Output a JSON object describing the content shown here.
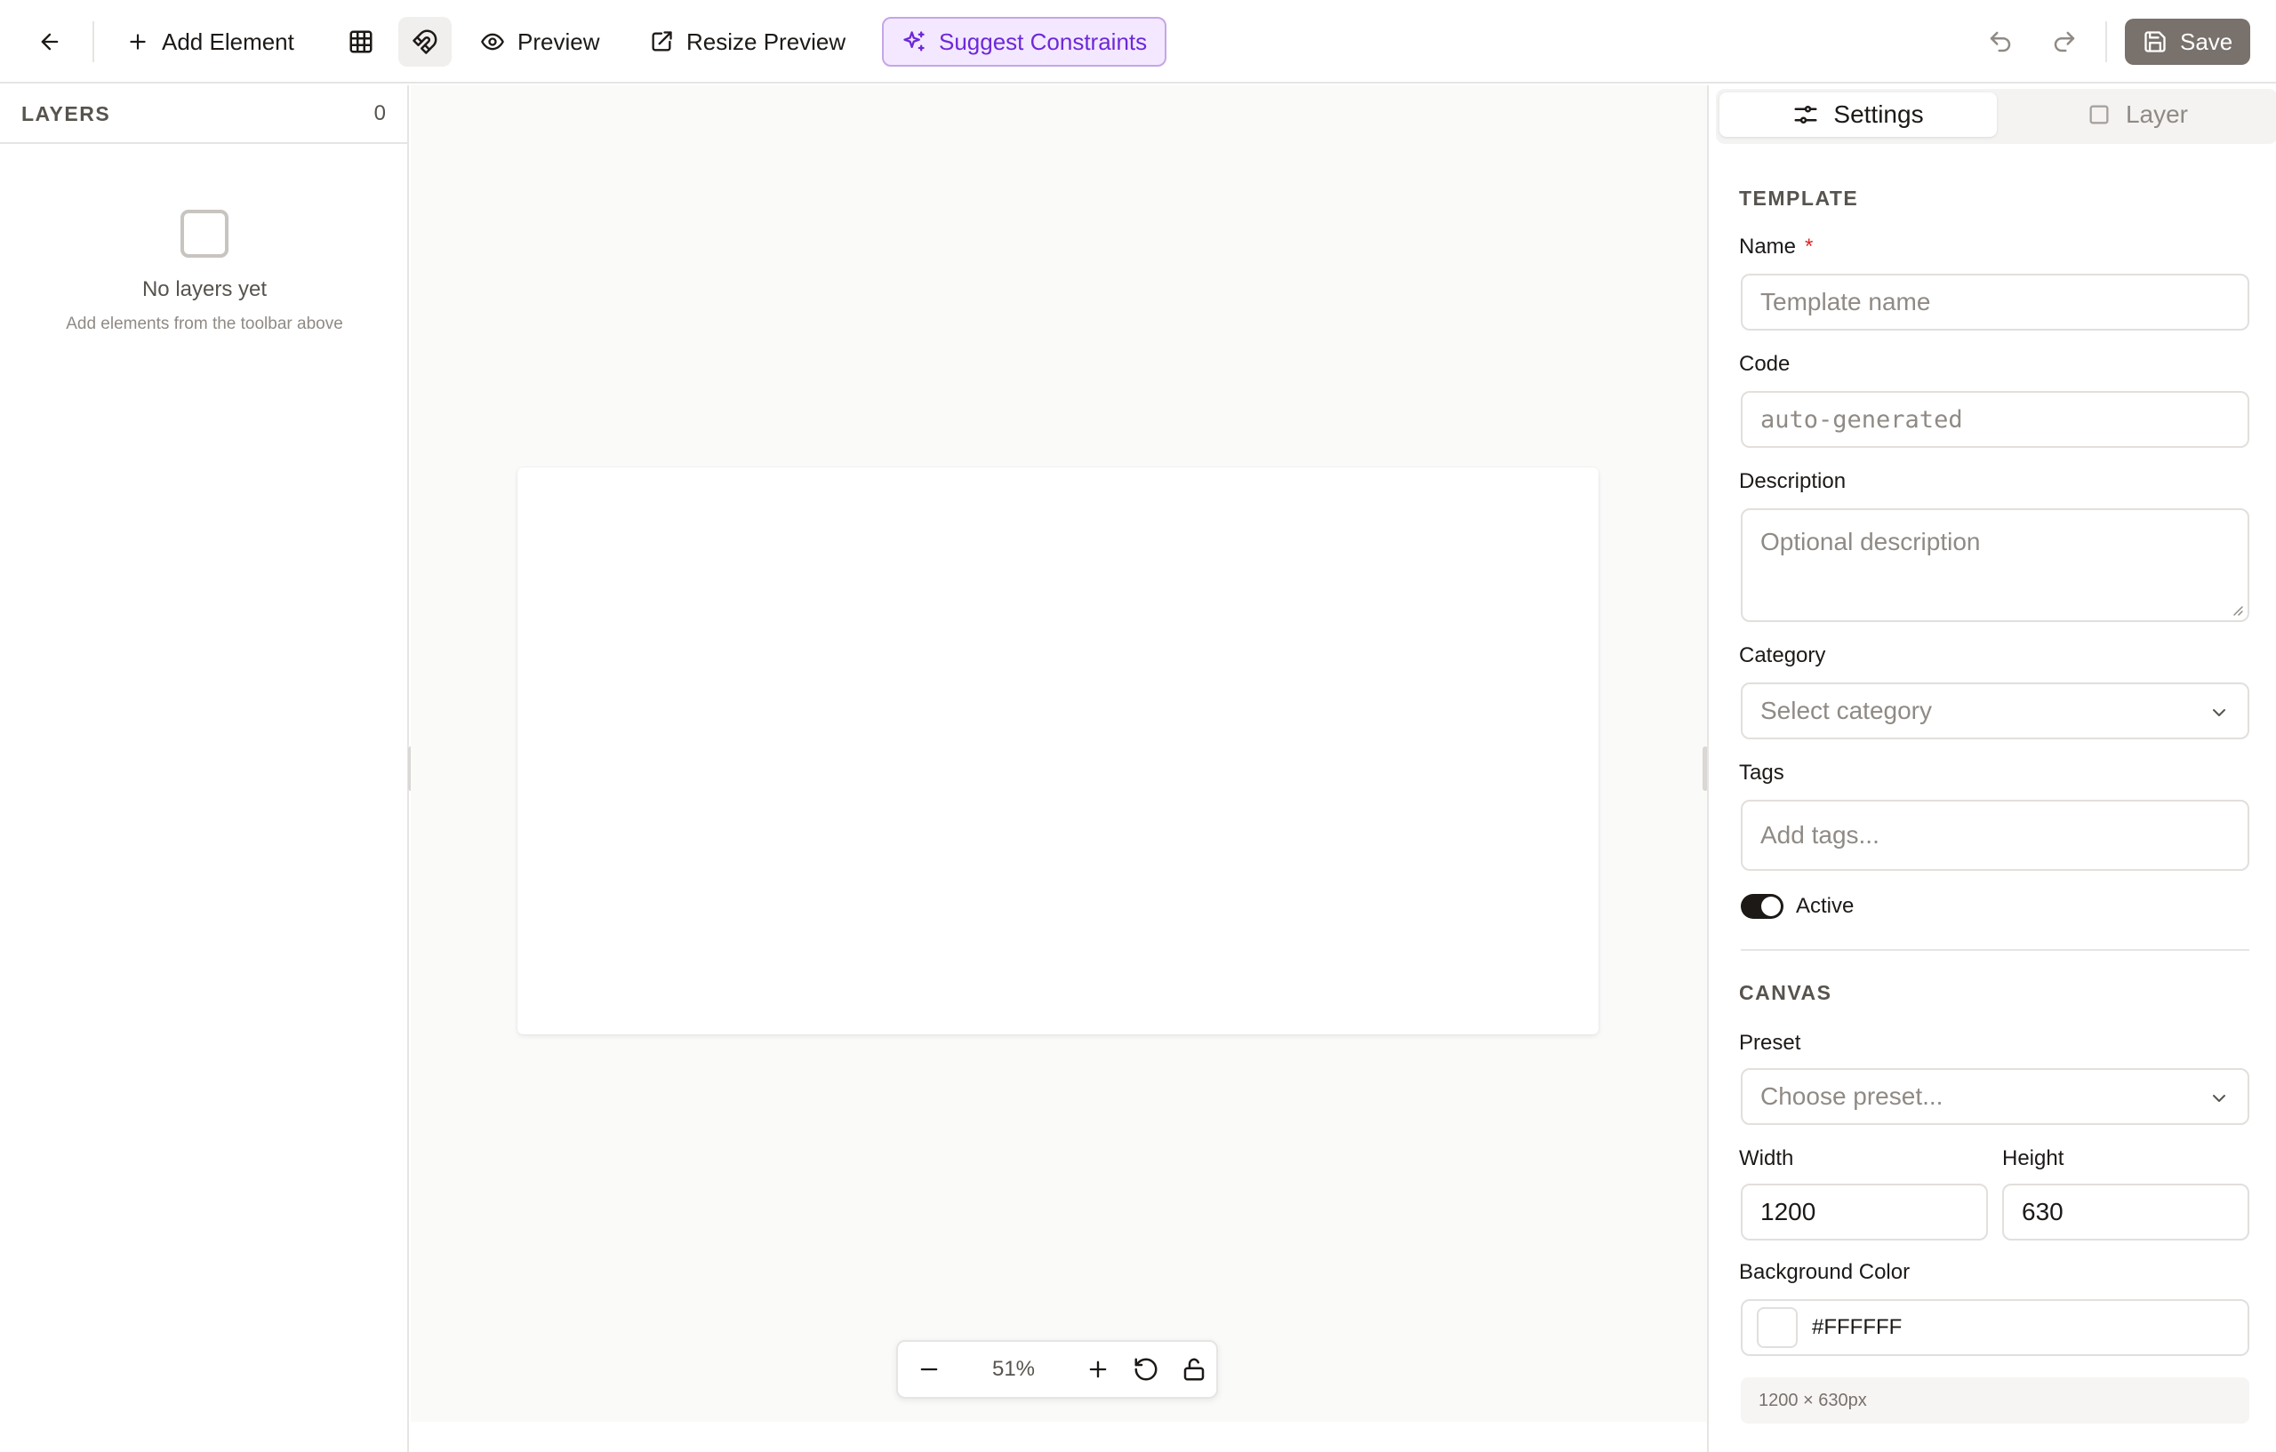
{
  "toolbar": {
    "add_element_label": "Add Element",
    "preview_label": "Preview",
    "resize_preview_label": "Resize Preview",
    "suggest_constraints_label": "Suggest Constraints",
    "save_label": "Save",
    "icons": [
      "arrow-left-icon",
      "plus-icon",
      "grid-icon",
      "magnet-icon",
      "eye-icon",
      "external-link-icon",
      "sparkles-icon",
      "undo-icon",
      "redo-icon",
      "save-icon"
    ]
  },
  "layers": {
    "title": "LAYERS",
    "count": "0",
    "empty_title": "No layers yet",
    "empty_subtitle": "Add elements from the toolbar above"
  },
  "zoom": {
    "level": "51%"
  },
  "panel": {
    "tabs": {
      "settings": "Settings",
      "layer": "Layer"
    },
    "template": {
      "section_title": "TEMPLATE",
      "name_label": "Name",
      "required_mark": "*",
      "name_placeholder": "Template name",
      "code_label": "Code",
      "code_placeholder": "auto-generated",
      "description_label": "Description",
      "description_placeholder": "Optional description",
      "category_label": "Category",
      "category_placeholder": "Select category",
      "tags_label": "Tags",
      "tags_placeholder": "Add tags...",
      "active_label": "Active",
      "active": true
    },
    "canvas": {
      "section_title": "CANVAS",
      "preset_label": "Preset",
      "preset_placeholder": "Choose preset...",
      "width_label": "Width",
      "width_value": "1200",
      "height_label": "Height",
      "height_value": "630",
      "bg_label": "Background Color",
      "bg_value": "#FFFFFF",
      "dims_text": "1200 × 630px"
    }
  },
  "colors": {
    "accent_purple": "#6d28d9",
    "accent_purple_bg": "#f3e8ff",
    "save_bg": "#78716c",
    "required": "#dc2626",
    "canvas_bg": "#fafaf9"
  }
}
